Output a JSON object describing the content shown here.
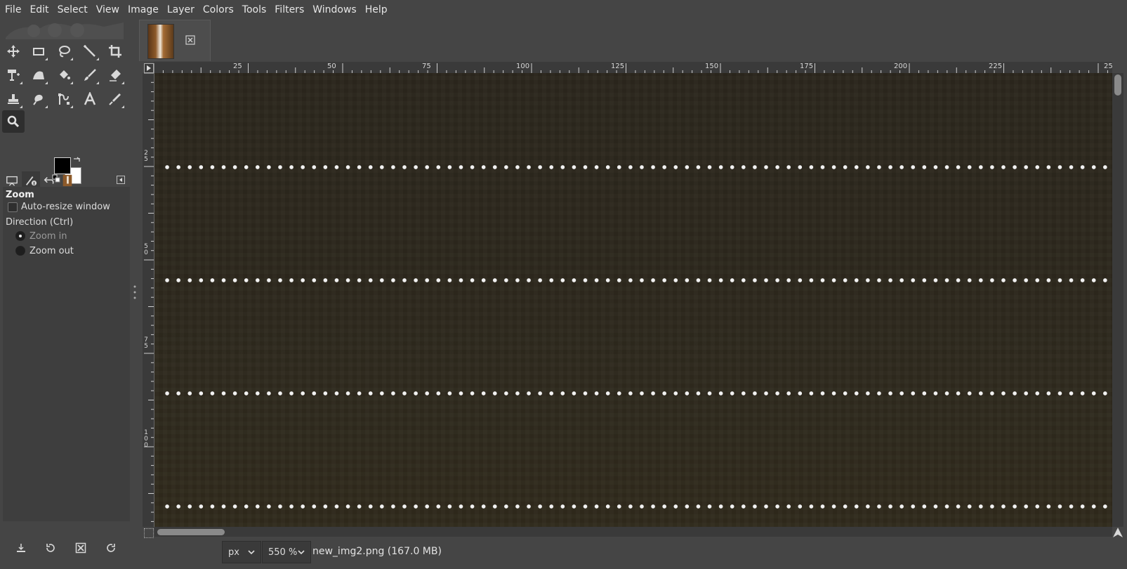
{
  "menubar": {
    "items": [
      "File",
      "Edit",
      "Select",
      "View",
      "Image",
      "Layer",
      "Colors",
      "Tools",
      "Filters",
      "Windows",
      "Help"
    ]
  },
  "toolbox": {
    "tools": [
      {
        "name": "move-tool",
        "icon": "move-icon"
      },
      {
        "name": "rect-select-tool",
        "icon": "rect-select-icon"
      },
      {
        "name": "free-select-tool",
        "icon": "lasso-icon"
      },
      {
        "name": "fuzzy-select-tool",
        "icon": "magic-wand-icon"
      },
      {
        "name": "crop-tool",
        "icon": "crop-icon"
      },
      {
        "name": "unified-transform-tool",
        "icon": "transform-icon"
      },
      {
        "name": "warp-transform-tool",
        "icon": "warp-icon"
      },
      {
        "name": "bucket-fill-tool",
        "icon": "bucket-icon"
      },
      {
        "name": "paintbrush-tool",
        "icon": "paintbrush-icon"
      },
      {
        "name": "eraser-tool",
        "icon": "eraser-icon"
      },
      {
        "name": "clone-tool",
        "icon": "clone-stamp-icon"
      },
      {
        "name": "smudge-tool",
        "icon": "smudge-icon"
      },
      {
        "name": "paths-tool",
        "icon": "paths-icon"
      },
      {
        "name": "text-tool",
        "icon": "text-icon"
      },
      {
        "name": "color-picker-tool",
        "icon": "eyedropper-icon"
      },
      {
        "name": "zoom-tool",
        "icon": "magnifier-icon"
      }
    ],
    "fg_color": "#000000",
    "bg_color": "#ffffff"
  },
  "tool_options": {
    "title": "Zoom",
    "auto_resize_label": "Auto-resize window",
    "auto_resize_checked": false,
    "direction_label": "Direction  (Ctrl)",
    "zoom_in_label": "Zoom in",
    "zoom_out_label": "Zoom out",
    "direction_selected": "Zoom in"
  },
  "ruler": {
    "h_labels": [
      "25",
      "50",
      "75",
      "100",
      "125",
      "150",
      "175",
      "200",
      "225",
      "25"
    ],
    "v_labels": [
      "25",
      "50",
      "75",
      "100"
    ]
  },
  "statusbar": {
    "unit": "px",
    "zoom": "550 %",
    "file_info": "new_img2.png (167.0 MB)"
  },
  "colors": {
    "background": "#454545",
    "canvas": "#2d281d",
    "guide": "#f2f2f2"
  }
}
